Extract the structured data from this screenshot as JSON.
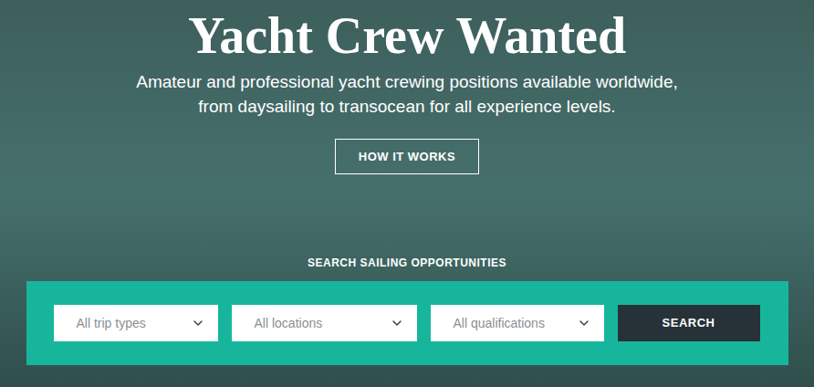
{
  "hero": {
    "title": "Yacht Crew Wanted",
    "subtitle": "Amateur and professional yacht crewing positions available worldwide, from daysailing to transocean for all experience levels.",
    "button": "HOW IT WORKS"
  },
  "search": {
    "heading": "SEARCH SAILING OPPORTUNITIES",
    "filters": [
      {
        "placeholder": "All trip types"
      },
      {
        "placeholder": "All locations"
      },
      {
        "placeholder": "All qualifications"
      }
    ],
    "button": "SEARCH"
  }
}
